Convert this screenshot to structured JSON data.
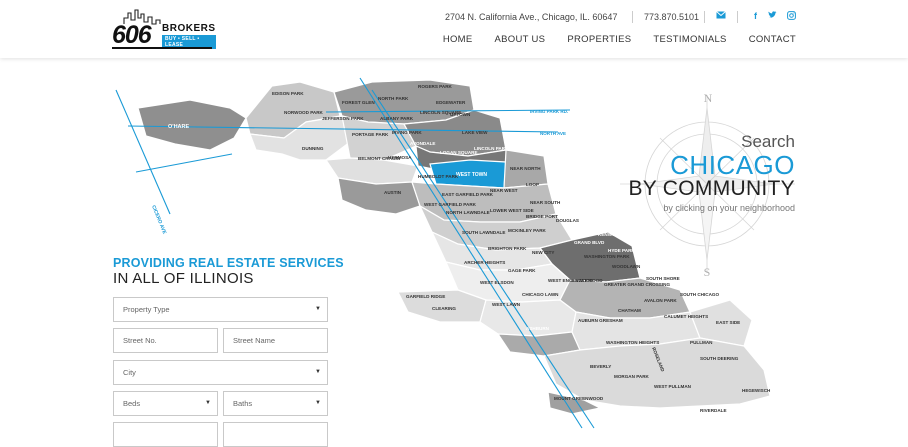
{
  "logo": {
    "number": "606",
    "name": "BROKERS",
    "tagline": "BUY • SELL • LEASE"
  },
  "header": {
    "address": "2704 N. California Ave., Chicago, IL. 60647",
    "phone": "773.870.5101"
  },
  "nav": [
    "HOME",
    "ABOUT US",
    "PROPERTIES",
    "TESTIMONIALS",
    "CONTACT"
  ],
  "hero": {
    "search": "Search",
    "city": "CHICAGO",
    "community": "BY COMMUNITY",
    "hint": "by clicking on your neighborhood"
  },
  "form": {
    "heading_top": "PROVIDING REAL ESTATE SERVICES",
    "heading_bottom": "IN ALL OF ILLINOIS",
    "property_type": "Property Type",
    "street_no": "Street No.",
    "street_name": "Street Name",
    "city": "City",
    "beds": "Beds",
    "baths": "Baths"
  },
  "compass": {
    "n": "N",
    "s": "S"
  },
  "map_labels": {
    "ohare": "O'HARE",
    "edison_park": "EDISON PARK",
    "norwood_park": "NORWOOD PARK",
    "forest_glen": "FOREST GLEN",
    "jefferson_park": "JEFFERSON PARK",
    "north_park": "NORTH PARK",
    "rogers_park": "ROGERS PARK",
    "edgewater": "EDGEWATER",
    "lincoln_square": "LINCOLN SQUARE",
    "uptown": "UPTOWN",
    "albany_park": "ALBANY PARK",
    "dunning": "DUNNING",
    "portage_park": "PORTAGE PARK",
    "irving_park": "IRVING PARK",
    "lake_view": "LAKE VIEW",
    "belmont_cragin": "BELMONT CRAGIN",
    "hermosa": "HERMOSA",
    "avondale": "AVONDALE",
    "logan_square": "LOGAN SQUARE",
    "lincoln_park": "LINCOLN PARK",
    "west_town": "WEST TOWN",
    "near_north": "NEAR NORTH",
    "austin": "AUSTIN",
    "humboldt_park": "HUMBOLDT PARK",
    "loop": "LOOP",
    "east_garfield": "EAST GARFIELD PARK",
    "near_west": "NEAR WEST",
    "west_garfield": "WEST GARFIELD PARK",
    "north_lawndale": "NORTH LAWNDALE",
    "lower_west": "LOWER WEST SIDE",
    "near_south": "NEAR SOUTH",
    "south_lawndale": "SOUTH LAWNDALE",
    "mckinley_park": "MCKINLEY PARK",
    "bridgeport": "BRIDGE PORT",
    "douglas": "DOUGLAS",
    "brighton_park": "BRIGHTON PARK",
    "new_city": "NEW CITY",
    "grand_blvd": "GRAND BLVD",
    "kenwood": "KENWOOD",
    "archer_heights": "ARCHER HEIGHTS",
    "gage_park": "GAGE PARK",
    "washington_park": "WASHINGTON PARK",
    "hyde_park": "HYDE PARK",
    "garfield_ridge": "GARFIELD RIDGE",
    "west_elsdon": "WEST ELSDON",
    "chicago_lawn": "CHICAGO LAWN",
    "west_englewood": "WEST ENGLEWOOD",
    "englewood": "ENGLEWOOD",
    "greater_grand": "GREATER GRAND CROSSING",
    "woodlawn": "WOODLAWN",
    "south_shore": "SOUTH SHORE",
    "clearing": "CLEARING",
    "west_lawn": "WEST LAWN",
    "chatham": "CHATHAM",
    "avalon_park": "AVALON PARK",
    "south_chicago": "SOUTH CHICAGO",
    "ashburn": "ASHBURN",
    "auburn_gresham": "AUBURN GRESHAM",
    "calumet_heights": "CALUMET HEIGHTS",
    "east_side": "EAST SIDE",
    "roseland": "ROSELAND",
    "pullman": "PULLMAN",
    "washington_heights": "WASHINGTON HEIGHTS",
    "beverly": "BEVERLY",
    "morgan_park": "MORGAN PARK",
    "west_pullman": "WEST PULLMAN",
    "south_deering": "SOUTH DEERING",
    "mount_greenwood": "MOUNT GREENWOOD",
    "riverdale": "RIVERDALE",
    "hegewisch": "HEGEWISCH",
    "irving_park_rd": "IRVING PARK RD.",
    "north_ave": "NORTH AVE",
    "cicero": "CICERO AVE"
  },
  "colors": {
    "accent": "#1a9ad6",
    "dark": "#222222"
  }
}
